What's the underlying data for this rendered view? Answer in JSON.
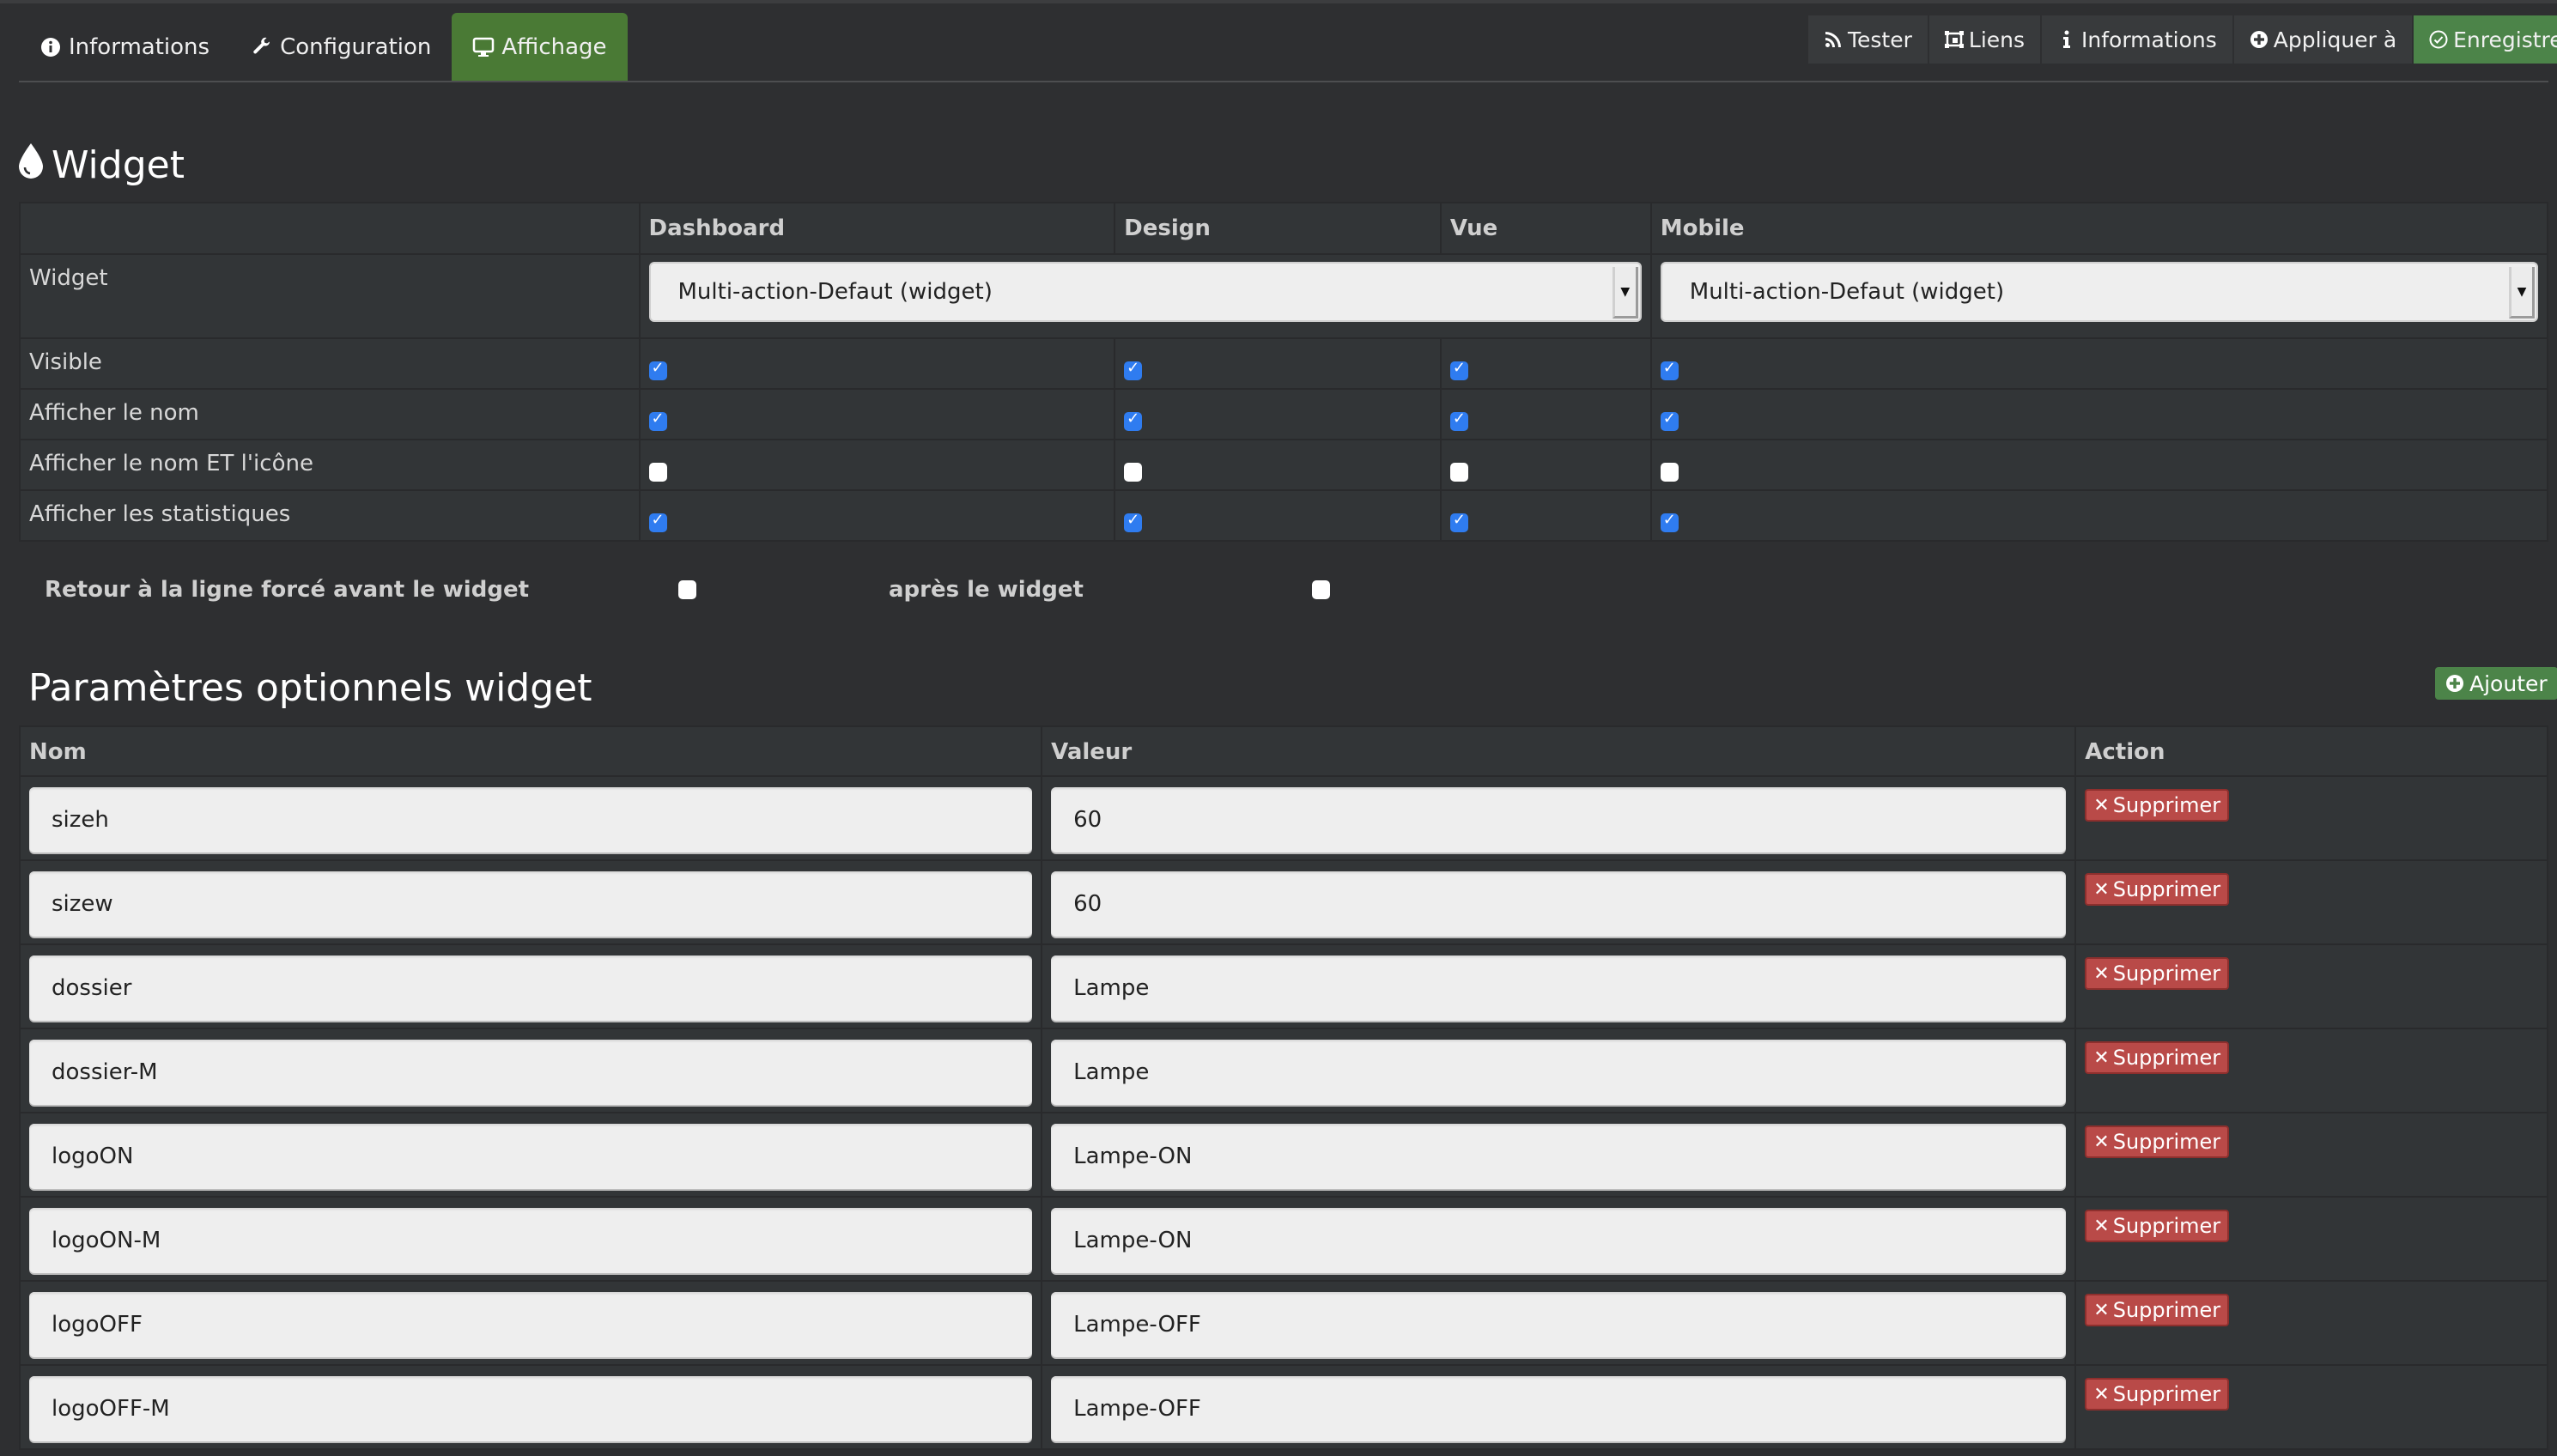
{
  "tabs": [
    {
      "label": "Informations",
      "icon": "info-circle-icon",
      "active": false
    },
    {
      "label": "Configuration",
      "icon": "wrench-icon",
      "active": false
    },
    {
      "label": "Affichage",
      "icon": "desktop-icon",
      "active": true
    }
  ],
  "toolbar": {
    "tester": "Tester",
    "liens": "Liens",
    "informations": "Informations",
    "appliquer": "Appliquer à",
    "enregistrer": "Enregistrer"
  },
  "widget_section": {
    "title": "Widget",
    "columns": [
      "",
      "Dashboard",
      "Design",
      "Vue",
      "Mobile"
    ],
    "widget_row_label": "Widget",
    "dashboard_widget": "Multi-action-Defaut (widget)",
    "mobile_widget": "Multi-action-Defaut (widget)",
    "rows": [
      {
        "label": "Visible",
        "dashboard": true,
        "design": true,
        "vue": true,
        "mobile": true
      },
      {
        "label": "Afficher le nom",
        "dashboard": true,
        "design": true,
        "vue": true,
        "mobile": true
      },
      {
        "label": "Afficher le nom ET l'icône",
        "dashboard": false,
        "design": false,
        "vue": false,
        "mobile": false
      },
      {
        "label": "Afficher les statistiques",
        "dashboard": true,
        "design": true,
        "vue": true,
        "mobile": true
      }
    ],
    "line_break_before_label": "Retour à la ligne forcé avant le widget",
    "line_break_before": false,
    "line_break_after_label": "après le widget",
    "line_break_after": false
  },
  "params_section": {
    "title": "Paramètres optionnels widget",
    "add_label": "Ajouter",
    "columns": [
      "Nom",
      "Valeur",
      "Action"
    ],
    "delete_label": "Supprimer",
    "rows": [
      {
        "name": "sizeh",
        "value": "60"
      },
      {
        "name": "sizew",
        "value": "60"
      },
      {
        "name": "dossier",
        "value": "Lampe"
      },
      {
        "name": "dossier-M",
        "value": "Lampe"
      },
      {
        "name": "logoON",
        "value": "Lampe-ON"
      },
      {
        "name": "logoON-M",
        "value": "Lampe-ON"
      },
      {
        "name": "logoOFF",
        "value": "Lampe-OFF"
      },
      {
        "name": "logoOFF-M",
        "value": "Lampe-OFF"
      }
    ]
  },
  "colors": {
    "background": "#2e2f31",
    "panel": "#323537",
    "active_tab": "#4a7a35",
    "save_button": "#4c8449",
    "delete_button": "#b94a48",
    "checkbox_checked": "#2f7cf0"
  }
}
